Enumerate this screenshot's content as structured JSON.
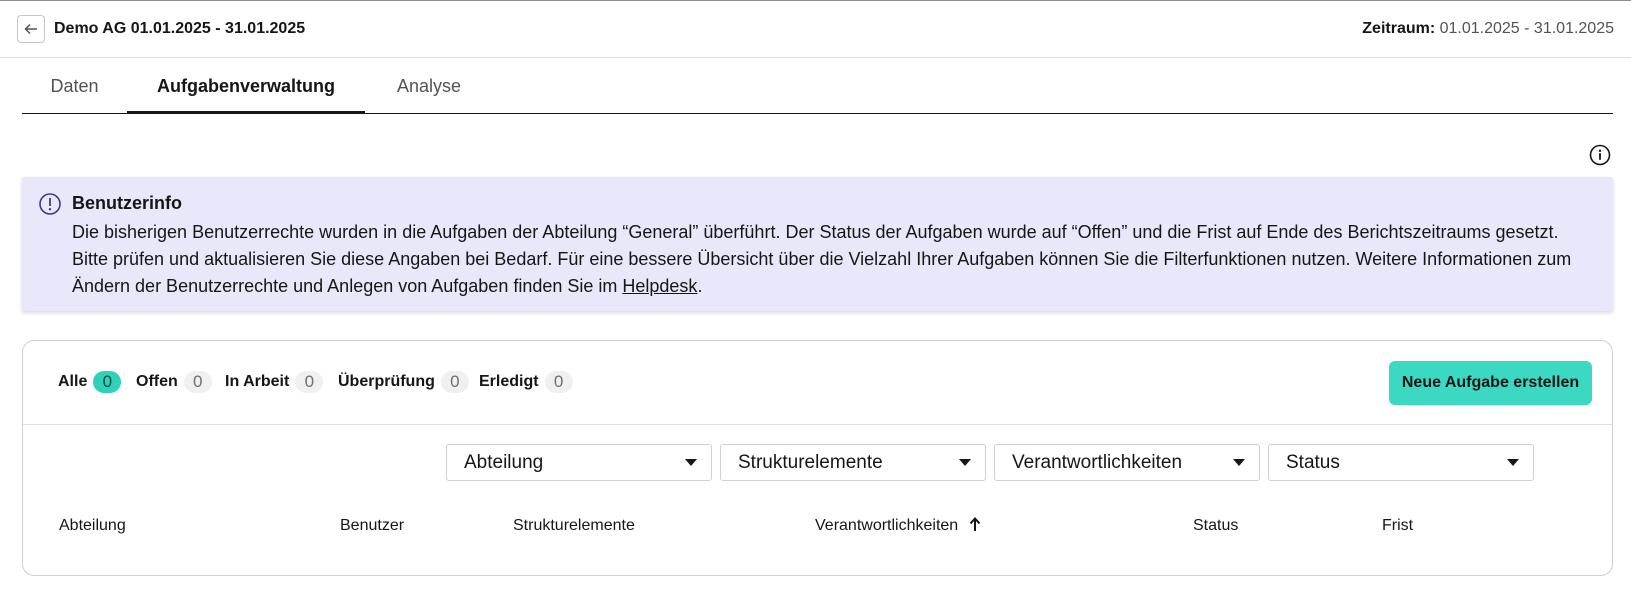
{
  "header": {
    "title": "Demo AG 01.01.2025 - 31.01.2025",
    "period_label": "Zeitraum:",
    "period_value": "01.01.2025 - 31.01.2025",
    "back_icon": "arrow-left-icon"
  },
  "tabs": [
    {
      "label": "Daten",
      "active": false
    },
    {
      "label": "Aufgabenverwaltung",
      "active": true
    },
    {
      "label": "Analyse",
      "active": false
    }
  ],
  "notice": {
    "icon": "exclamation-circle-icon",
    "title": "Benutzerinfo",
    "text": "Die bisherigen Benutzerrechte wurden in die Aufgaben der Abteilung “General” überführt. Der Status der Aufgaben wurde auf “Offen” und die Frist auf Ende des Berichtszeitraums gesetzt. Bitte prüfen und aktualisieren Sie diese Angaben bei Bedarf. Für eine bessere Übersicht über die Vielzahl Ihrer Aufgaben können Sie die Filterfunktionen nutzen. Weitere Informationen zum Ändern der Benutzerrechte und Anlegen von Aufgaben finden Sie im ",
    "link": "Helpdesk",
    "text_end": "."
  },
  "status_filters": [
    {
      "label": "Alle",
      "count": "0",
      "active": true
    },
    {
      "label": "Offen",
      "count": "0",
      "active": false
    },
    {
      "label": "In Arbeit",
      "count": "0",
      "active": false
    },
    {
      "label": "Überprüfung",
      "count": "0",
      "active": false
    },
    {
      "label": "Erledigt",
      "count": "0",
      "active": false
    }
  ],
  "new_task_button": "Neue Aufgabe erstellen",
  "dropdowns": [
    {
      "label": "Abteilung"
    },
    {
      "label": "Strukturelemente"
    },
    {
      "label": "Verantwortlichkeiten"
    },
    {
      "label": "Status"
    }
  ],
  "table": {
    "columns": [
      "Abteilung",
      "Benutzer",
      "Strukturelemente",
      "Verantwortlichkeiten",
      "Status",
      "Frist"
    ],
    "sorted_column": "Verantwortlichkeiten",
    "sort_direction": "ascending"
  },
  "colors": {
    "accent": "#3bd9c2",
    "notice_bg": "#e8e8fa"
  }
}
